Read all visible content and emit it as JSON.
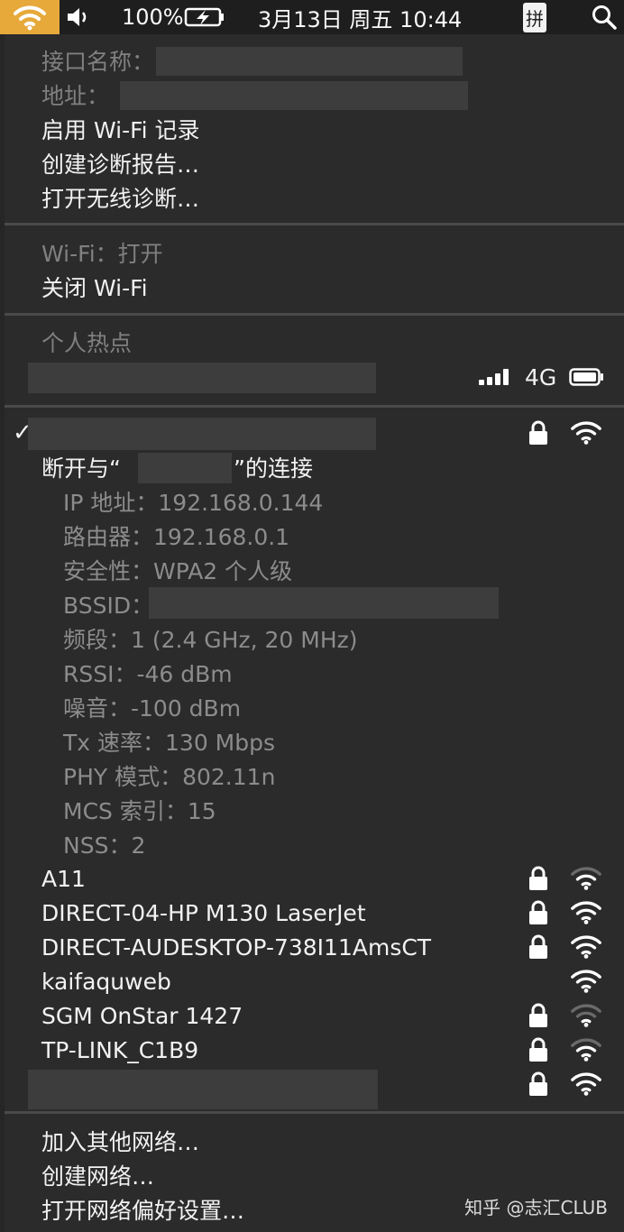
{
  "menubar": {
    "battery_percent": "100%",
    "datetime": "3月13日 周五  10:44",
    "input_method": "拼"
  },
  "interface": {
    "name_label": "接口名称：",
    "address_label": "地址："
  },
  "actions_top": {
    "enable_logging": "启用 Wi-Fi 记录",
    "create_diag": "创建诊断报告…",
    "open_wireless_diag": "打开无线诊断…"
  },
  "wifi": {
    "status": "Wi-Fi：打开",
    "turn_off": "关闭 Wi-Fi"
  },
  "hotspot": {
    "header": "个人热点",
    "signal_type": "4G"
  },
  "connected": {
    "disconnect_prefix": "断开与“",
    "disconnect_suffix": "”的连接",
    "ip": "IP 地址：192.168.0.144",
    "router": "路由器：192.168.0.1",
    "security": "安全性：WPA2 个人级",
    "bssid_label": "BSSID：",
    "channel": "频段：1 (2.4 GHz, 20 MHz)",
    "rssi": "RSSI：-46 dBm",
    "noise": "噪音：-100 dBm",
    "tx_rate": "Tx 速率：130 Mbps",
    "phy": "PHY 模式：802.11n",
    "mcs": "MCS 索引：15",
    "nss": "NSS：2"
  },
  "networks": [
    {
      "name": "A11",
      "locked": true,
      "signal": 3
    },
    {
      "name": "DIRECT-04-HP M130 LaserJet",
      "locked": true,
      "signal": 4
    },
    {
      "name": "DIRECT-AUDESKTOP-738I11AmsCT",
      "locked": true,
      "signal": 4
    },
    {
      "name": "kaifaquweb",
      "locked": false,
      "signal": 4
    },
    {
      "name": "SGM OnStar 1427",
      "locked": true,
      "signal": 2
    },
    {
      "name": "TP-LINK_C1B9",
      "locked": true,
      "signal": 3
    },
    {
      "name": "",
      "locked": true,
      "signal": 4
    }
  ],
  "actions_bottom": {
    "join_other": "加入其他网络…",
    "create_network": "创建网络…",
    "open_prefs": "打开网络偏好设置…"
  },
  "watermark": "知乎 @志汇CLUB",
  "colors": {
    "menubar_bg": "#1e1e1e",
    "menu_bg": "#2b2b2c",
    "highlight_wifi": "#e6a93a",
    "disabled_text": "#808080"
  }
}
